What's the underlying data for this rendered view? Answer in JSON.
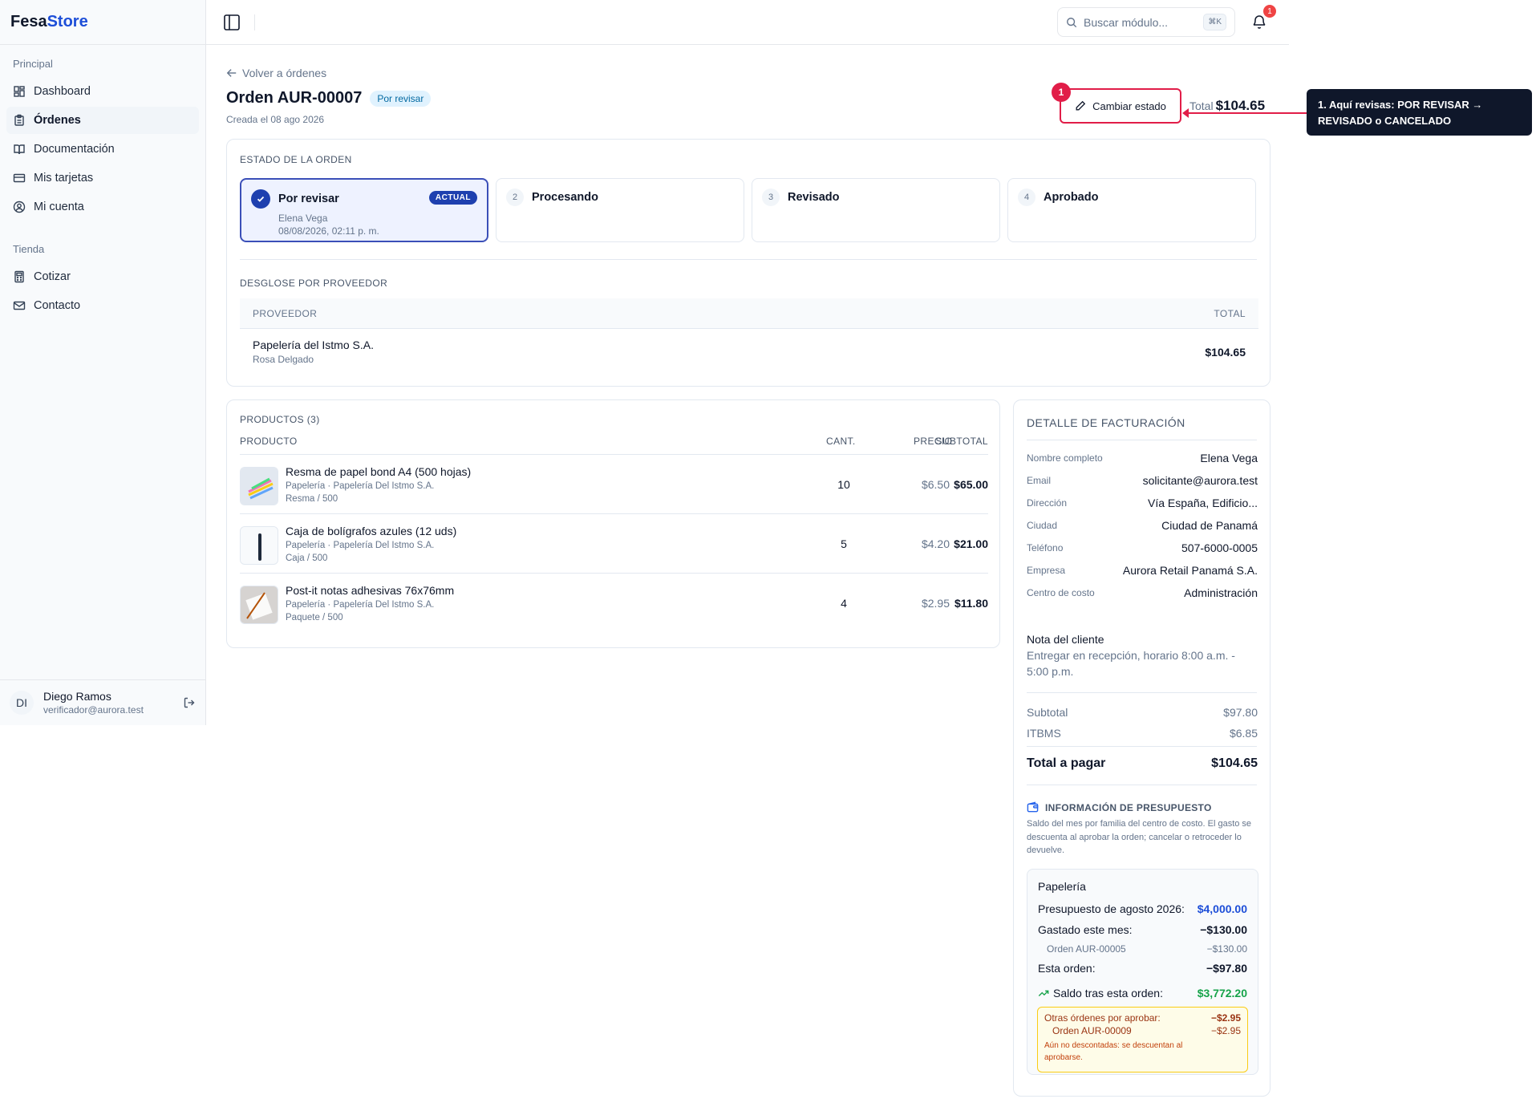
{
  "brand": {
    "part1": "Fesa",
    "part2": "Store"
  },
  "sidebar": {
    "section_main": "Principal",
    "main_items": [
      {
        "label": "Dashboard",
        "icon": "dashboard-icon"
      },
      {
        "label": "Órdenes",
        "icon": "clipboard-icon",
        "active": true
      },
      {
        "label": "Documentación",
        "icon": "book-icon"
      },
      {
        "label": "Mis tarjetas",
        "icon": "credit-card-icon"
      },
      {
        "label": "Mi cuenta",
        "icon": "user-circle-icon"
      }
    ],
    "section_store": "Tienda",
    "store_items": [
      {
        "label": "Cotizar",
        "icon": "calculator-icon"
      },
      {
        "label": "Contacto",
        "icon": "mail-icon"
      }
    ],
    "user": {
      "initials": "DI",
      "name": "Diego Ramos",
      "email": "verificador@aurora.test"
    }
  },
  "topbar": {
    "search_placeholder": "Buscar módulo...",
    "shortcut": "⌘K",
    "notifications": "1"
  },
  "order": {
    "back_label": "Volver a órdenes",
    "title": "Orden AUR-00007",
    "status_pill": "Por revisar",
    "created": "Creada el 08 ago 2026",
    "change_status_label": "Cambiar estado",
    "step_badge": "1",
    "total_label": "Total",
    "total_value": "$104.65"
  },
  "callout": {
    "text": "1. Aquí revisas: POR REVISAR → REVISADO o CANCELADO"
  },
  "status": {
    "label": "ESTADO DE LA ORDEN",
    "steps": [
      {
        "num": "1",
        "name": "Por revisar",
        "badge": "ACTUAL",
        "user": "Elena Vega",
        "date": "08/08/2026, 02:11 p. m."
      },
      {
        "num": "2",
        "name": "Procesando"
      },
      {
        "num": "3",
        "name": "Revisado"
      },
      {
        "num": "4",
        "name": "Aprobado"
      }
    ]
  },
  "providers": {
    "label": "DESGLOSE POR PROVEEDOR",
    "col_provider": "PROVEEDOR",
    "col_total": "TOTAL",
    "rows": [
      {
        "name": "Papelería del Istmo S.A.",
        "contact": "Rosa Delgado",
        "total": "$104.65"
      }
    ]
  },
  "products": {
    "label": "PRODUCTOS (3)",
    "col_product": "PRODUCTO",
    "col_qty": "CANT.",
    "col_price": "PRECIO",
    "col_subtotal": "SUBTOTAL",
    "rows": [
      {
        "name": "Resma de papel bond A4 (500 hojas)",
        "category": "Papelería · Papelería Del Istmo S.A.",
        "unit": "Resma / 500",
        "qty": "10",
        "price": "$6.50",
        "subtotal": "$65.00"
      },
      {
        "name": "Caja de bolígrafos azules (12 uds)",
        "category": "Papelería · Papelería Del Istmo S.A.",
        "unit": "Caja / 500",
        "qty": "5",
        "price": "$4.20",
        "subtotal": "$21.00"
      },
      {
        "name": "Post-it notas adhesivas 76x76mm",
        "category": "Papelería · Papelería Del Istmo S.A.",
        "unit": "Paquete / 500",
        "qty": "4",
        "price": "$2.95",
        "subtotal": "$11.80"
      }
    ]
  },
  "billing": {
    "title": "DETALLE DE FACTURACIÓN",
    "fields": [
      {
        "k": "Nombre completo",
        "v": "Elena Vega"
      },
      {
        "k": "Email",
        "v": "solicitante@aurora.test"
      },
      {
        "k": "Dirección",
        "v": "Vía España, Edificio..."
      },
      {
        "k": "Ciudad",
        "v": "Ciudad de Panamá"
      },
      {
        "k": "Teléfono",
        "v": "507-6000-0005"
      },
      {
        "k": "Empresa",
        "v": "Aurora Retail Panamá S.A."
      },
      {
        "k": "Centro de costo",
        "v": "Administración"
      }
    ],
    "note_title": "Nota del cliente",
    "note_body": "Entregar en recepción, horario 8:00 a.m. - 5:00 p.m.",
    "subtotal_label": "Subtotal",
    "subtotal": "$97.80",
    "tax_label": "ITBMS",
    "tax": "$6.85",
    "grand_label": "Total a pagar",
    "grand": "$104.65"
  },
  "budget": {
    "title": "INFORMACIÓN DE PRESUPUESTO",
    "desc": "Saldo del mes por familia del centro de costo. El gasto se descuenta al aprobar la orden; cancelar o retroceder lo devuelve.",
    "family": "Papelería",
    "budget_label": "Presupuesto de agosto 2026:",
    "budget_value": "$4,000.00",
    "spent_label": "Gastado este mes:",
    "spent_value": "−$130.00",
    "spent_order_label": "Orden AUR-00005",
    "spent_order_value": "−$130.00",
    "this_label": "Esta orden:",
    "this_value": "−$97.80",
    "balance_label": "Saldo tras esta orden:",
    "balance_value": "$3,772.20",
    "pending_label": "Otras órdenes por aprobar:",
    "pending_value": "−$2.95",
    "pending_order_label": "Orden AUR-00009",
    "pending_order_value": "−$2.95",
    "pending_note": "Aún no descontadas: se descuentan al aprobarse."
  },
  "colors": {
    "accent": "#1d4ed8",
    "highlight": "#e11d48",
    "success": "#16a34a"
  }
}
